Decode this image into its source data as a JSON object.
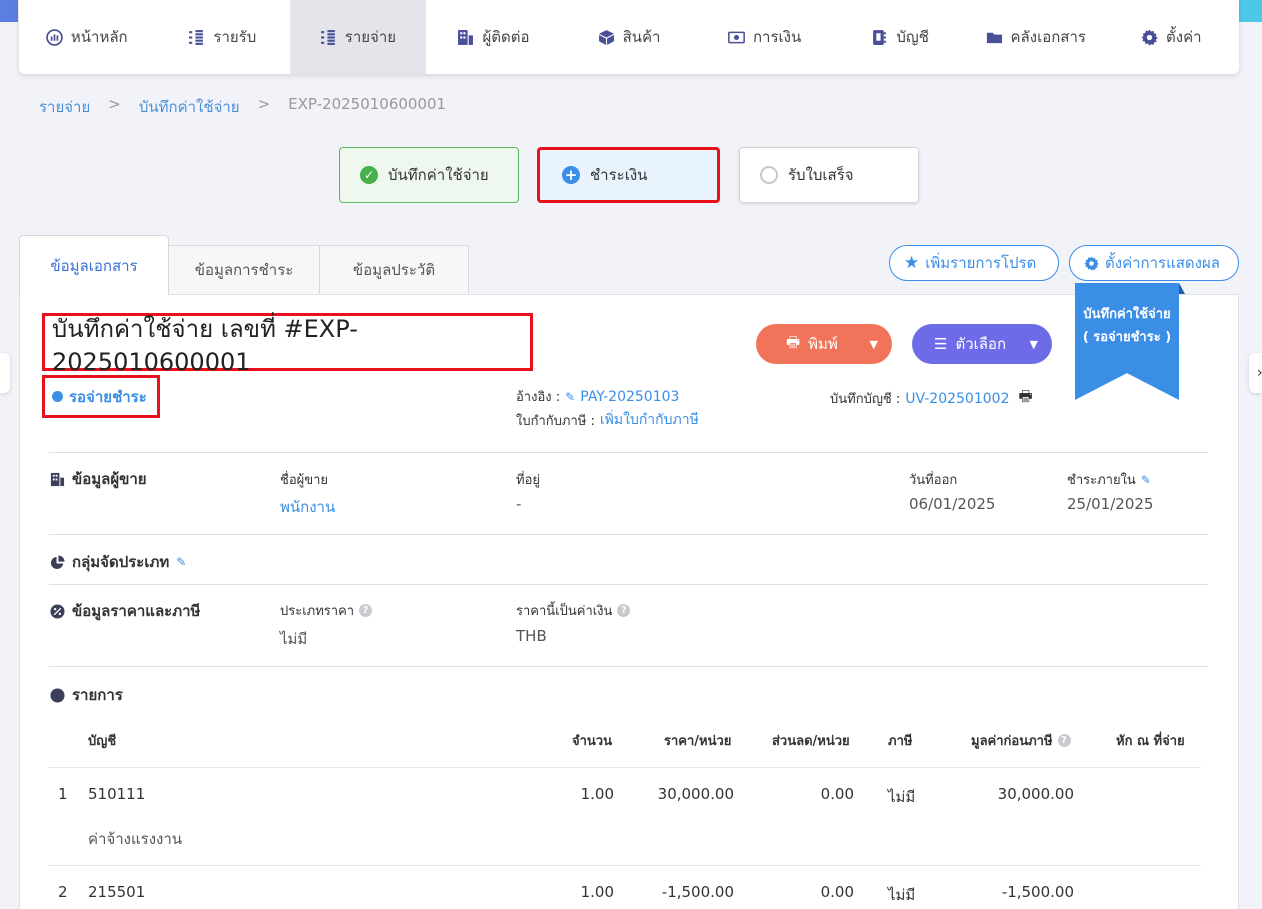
{
  "nav": {
    "items": [
      {
        "label": "หน้าหลัก",
        "icon": "dashboard-icon"
      },
      {
        "label": "รายรับ",
        "icon": "income-icon"
      },
      {
        "label": "รายจ่าย",
        "icon": "expense-icon"
      },
      {
        "label": "ผู้ติดต่อ",
        "icon": "contacts-icon"
      },
      {
        "label": "สินค้า",
        "icon": "product-box-icon"
      },
      {
        "label": "การเงิน",
        "icon": "money-icon"
      },
      {
        "label": "บัญชี",
        "icon": "account-book-icon"
      },
      {
        "label": "คลังเอกสาร",
        "icon": "folder-icon"
      },
      {
        "label": "ตั้งค่า",
        "icon": "gear-icon"
      }
    ],
    "active_index": 2
  },
  "breadcrumb": {
    "items": [
      "รายจ่าย",
      "บันทึกค่าใช้จ่าย",
      "EXP-2025010600001"
    ],
    "separator": ">"
  },
  "steps": [
    {
      "label": "บันทึกค่าใช้จ่าย",
      "state": "done"
    },
    {
      "label": "ชำระเงิน",
      "state": "current"
    },
    {
      "label": "รับใบเสร็จ",
      "state": "pending"
    }
  ],
  "tabs": [
    "ข้อมูลเอกสาร",
    "ข้อมูลการชำระ",
    "ข้อมูลประวัติ"
  ],
  "actions": {
    "favorite_label": "เพิ่มรายการโปรด",
    "display_settings_label": "ตั้งค่าการแสดงผล",
    "print_label": "พิมพ์",
    "options_label": "ตัวเลือก"
  },
  "ribbon": {
    "line1": "บันทึกค่าใช้จ่าย",
    "line2": "( รอจ่ายชำระ )"
  },
  "document": {
    "title": "บันทึกค่าใช้จ่าย เลขที่ #EXP-2025010600001",
    "status": "รอจ่ายชำระ",
    "reference_label": "อ้างอิง :",
    "reference_value": "PAY-20250103",
    "tax_invoice_label": "ใบกำกับภาษี :",
    "tax_invoice_value": "เพิ่มใบกำกับภาษี",
    "ledger_label": "บันทึกบัญชี :",
    "ledger_value": "UV-202501002"
  },
  "vendor": {
    "section_title": "ข้อมูลผู้ขาย",
    "name_label": "ชื่อผู้ขาย",
    "name_value": "พนักงาน",
    "address_label": "ที่อยู่",
    "address_value": "-",
    "issue_date_label": "วันที่ออก",
    "issue_date_value": "06/01/2025",
    "due_label": "ชำระภายใน",
    "due_value": "25/01/2025"
  },
  "category": {
    "section_title": "กลุ่มจัดประเภท"
  },
  "pricing": {
    "section_title": "ข้อมูลราคาและภาษี",
    "price_type_label": "ประเภทราคา",
    "price_type_value": "ไม่มี",
    "currency_label": "ราคานี้เป็นค่าเงิน",
    "currency_value": "THB"
  },
  "items": {
    "section_title": "รายการ",
    "headers": {
      "account": "บัญชี",
      "qty": "จำนวน",
      "unit_price": "ราคา/หน่วย",
      "discount": "ส่วนลด/หน่วย",
      "tax": "ภาษี",
      "pre_tax": "มูลค่าก่อนภาษี",
      "withholding": "หัก ณ ที่จ่าย"
    },
    "rows": [
      {
        "no": "1",
        "account": "510111",
        "desc": "ค่าจ้างแรงงาน",
        "qty": "1.00",
        "unit_price": "30,000.00",
        "discount": "0.00",
        "tax": "ไม่มี",
        "pre_tax": "30,000.00"
      },
      {
        "no": "2",
        "account": "215501",
        "desc": "",
        "qty": "1.00",
        "unit_price": "-1,500.00",
        "discount": "0.00",
        "tax": "ไม่มี",
        "pre_tax": "-1,500.00"
      }
    ]
  }
}
